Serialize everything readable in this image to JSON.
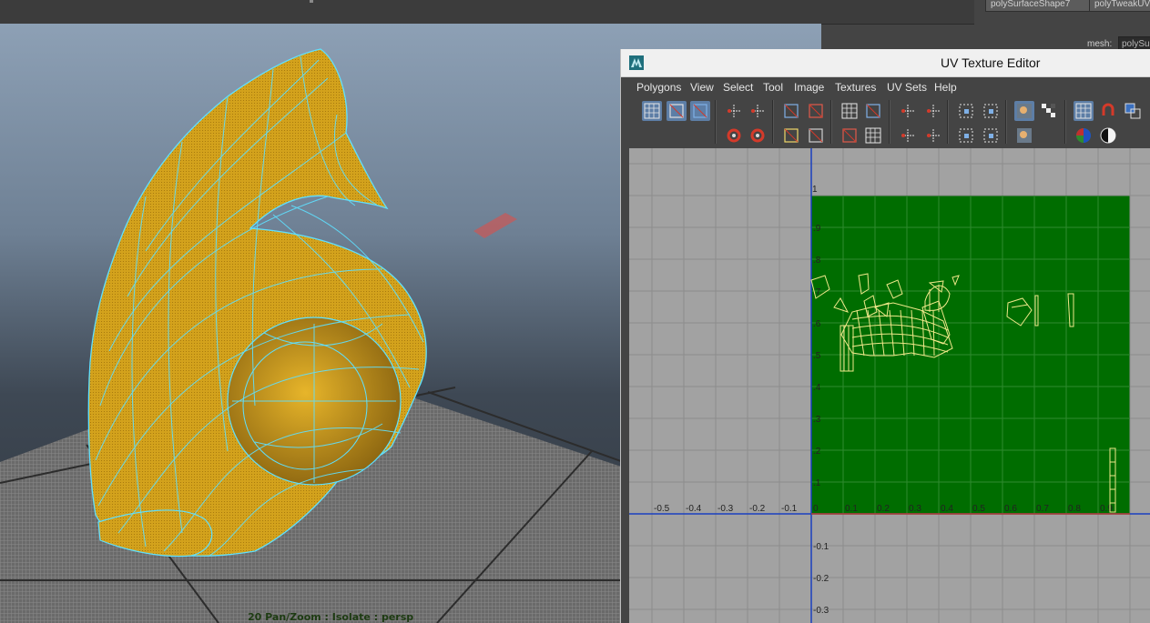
{
  "viewport": {
    "hud_text": "20 Pan/Zoom : Isolate : persp"
  },
  "attribute_editor": {
    "tabs": [
      "polySurfaceShape7",
      "polyTweakUV"
    ],
    "mesh_label": "mesh:",
    "mesh_value": "polySurface"
  },
  "uv_editor": {
    "title": "UV Texture Editor",
    "menus": [
      "Polygons",
      "View",
      "Select",
      "Tool",
      "Image",
      "Textures",
      "UV Sets",
      "Help"
    ],
    "colors": {
      "texture_fill": "#006d00",
      "grid_bg": "#a2a2a2",
      "uv_shell_lines": "#f0e88a",
      "axis_line": "#1a3fbf",
      "mesh_yellow": "#d9a51b",
      "wire_cyan": "#5fe0ff"
    },
    "axis": {
      "top_label": "1",
      "v_labels": [
        ".9",
        ".8",
        ".7",
        ".6",
        ".5",
        ".4",
        ".3",
        ".2",
        ".1"
      ],
      "neg_v_labels": [
        "-0.1",
        "-0.2",
        "-0.3"
      ],
      "u_labels": [
        ".6",
        "-0.5",
        "-0.4",
        "-0.3",
        "-0.2",
        "-0.1",
        "0",
        "0.1",
        "0.2",
        "0.3",
        "0.4",
        "0.5",
        "0.6",
        "0.7",
        "0.8",
        "0.9"
      ]
    },
    "toolbar_icons": [
      "uv-lattice-icon",
      "uv-smudge-icon",
      "uv-move-icon",
      "flip-u-icon",
      "flip-v-icon",
      "rotate-ccw-icon",
      "rotate-cw-icon",
      "cut-uv-icon",
      "sew-uv-icon",
      "split-uv-icon",
      "merge-uv-icon",
      "layout-uv-icon",
      "unfold-icon",
      "straighten-icon",
      "grid-uv-icon",
      "align-left-icon",
      "align-right-icon",
      "align-bottom-icon",
      "align-top-icon",
      "select-shell-icon",
      "select-border-icon",
      "select-faces-icon",
      "select-uvs-icon",
      "image-display-icon",
      "checker-icon",
      "dim-image-icon",
      "grid-display-icon",
      "pixel-snap-icon",
      "shaded-uv-icon",
      "rgb-channels-icon",
      "alpha-channel-icon"
    ]
  }
}
